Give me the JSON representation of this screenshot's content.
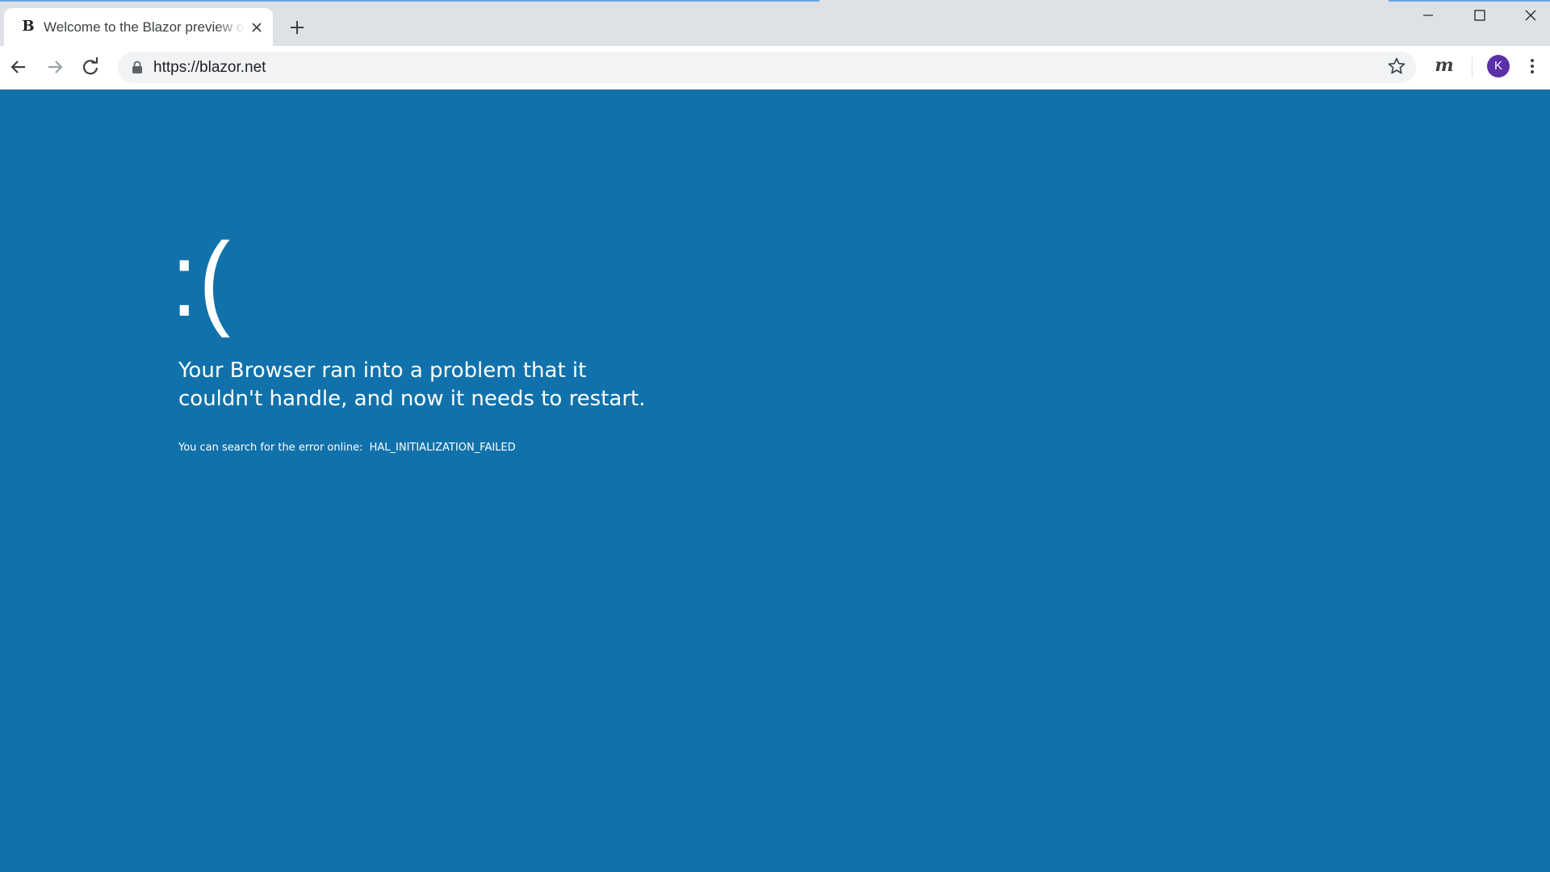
{
  "browser": {
    "tab": {
      "favicon": "B",
      "title": "Welcome to the Blazor preview o",
      "close_icon": "close-icon"
    },
    "new_tab_icon": "plus-icon",
    "window_controls": [
      "minimize-icon",
      "maximize-icon",
      "close-icon"
    ],
    "toolbar": {
      "url": "https://blazor.net",
      "extension_label": "m",
      "profile_initial": "K"
    },
    "colors": {
      "profile_avatar": "#5b2fa8",
      "page_background": "#1172ab",
      "title_bar": "#dee1e6"
    }
  },
  "page": {
    "sad_face": ":(",
    "headline": "Your Browser ran into a problem that it couldn't handle, and now it needs to restart.",
    "search_text": "You can search for the error online:",
    "error_code": "HAL_INITIALIZATION_FAILED"
  }
}
